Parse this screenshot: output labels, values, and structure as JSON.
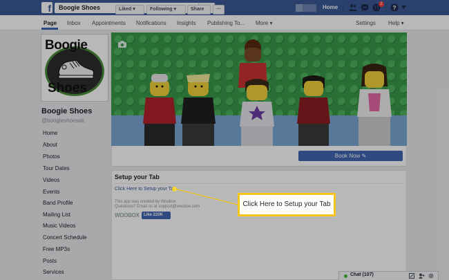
{
  "topbar": {
    "search_value": "Boogie Shoes",
    "home_label": "Home",
    "notification_count": "2"
  },
  "nav": {
    "items": [
      "Page",
      "Inbox",
      "Appointments",
      "Notifications",
      "Insights",
      "Publishing To...",
      "More ▾"
    ],
    "settings": "Settings",
    "help": "Help ▾"
  },
  "page": {
    "name": "Boogie Shoes",
    "handle": "@boogieshoesak",
    "logo_top": "Boogie",
    "logo_bottom": "Shoes"
  },
  "sidebar": {
    "items": [
      "Home",
      "About",
      "Photos",
      "Tour Dates",
      "Videos",
      "Events",
      "Band Profile",
      "Mailing List",
      "Music Videos",
      "Concert Schedule",
      "Free MP3s",
      "Posts",
      "Services"
    ]
  },
  "actions": {
    "liked": "Liked ▾",
    "following": "Following ▾",
    "share": "Share",
    "more": "···",
    "book": "Book Now ✎"
  },
  "setup": {
    "title": "Setup your Tab",
    "link": "Click Here to Setup your Tab",
    "credit_line1": "This app was created by Woobox",
    "credit_line2": "Questions? Email us at support@woobox.com",
    "brand": "WOOBOX",
    "like_label": "Like 220K"
  },
  "callout": {
    "text": "Click Here to Setup your Tab"
  },
  "chat": {
    "label": "Chat (107)"
  },
  "colors": {
    "brand": "#3b5998",
    "accent": "#4267b2",
    "callout_border": "#f5c518"
  }
}
